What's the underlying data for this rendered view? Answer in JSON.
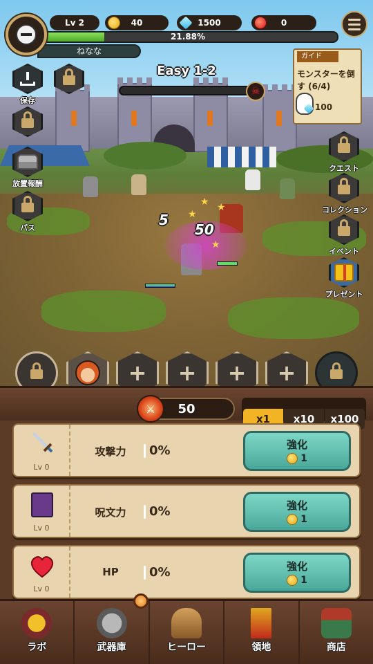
{
  "hud": {
    "level": "Lv 2",
    "gold": "40",
    "gems": "1500",
    "rubies": "0",
    "xp_percent_text": "21.88%",
    "xp_fraction": 0.2188,
    "player_name": "ねなな"
  },
  "stage": {
    "title": "Easy 1-2"
  },
  "guide": {
    "title": "ガイド",
    "text": "モンスターを倒す (6/4)",
    "reward": "100"
  },
  "left_menu": [
    {
      "label": "保存"
    },
    {
      "label": ""
    },
    {
      "label": "放置報酬"
    },
    {
      "label": "パス"
    }
  ],
  "right_menu": [
    {
      "label": "クエスト"
    },
    {
      "label": "コレクション"
    },
    {
      "label": "イベント"
    },
    {
      "label": "プレゼント"
    }
  ],
  "battle": {
    "damage_1": "5",
    "damage_2": "50"
  },
  "power": {
    "value": "50"
  },
  "multipliers": [
    "x1",
    "x10",
    "x100"
  ],
  "upgrades": [
    {
      "name": "攻撃力",
      "level": "Lv 0",
      "value": "0%",
      "button": "強化",
      "cost": "1"
    },
    {
      "name": "呪文力",
      "level": "Lv 0",
      "value": "0%",
      "button": "強化",
      "cost": "1"
    },
    {
      "name": "HP",
      "level": "Lv 0",
      "value": "0%",
      "button": "強化",
      "cost": "1"
    }
  ],
  "nav": [
    {
      "label": "ラボ",
      "icon": "lab-trophy-icon"
    },
    {
      "label": "武器庫",
      "icon": "armory-icon"
    },
    {
      "label": "ヒーロー",
      "icon": "hero-helmet-icon"
    },
    {
      "label": "領地",
      "icon": "territory-banner-icon"
    },
    {
      "label": "商店",
      "icon": "shop-icon"
    }
  ],
  "colors": {
    "accent_gold": "#f2b424",
    "upgrade_teal": "#4aa89a",
    "panel_brown": "#5b3a26",
    "xp_green": "#6cc43a"
  }
}
